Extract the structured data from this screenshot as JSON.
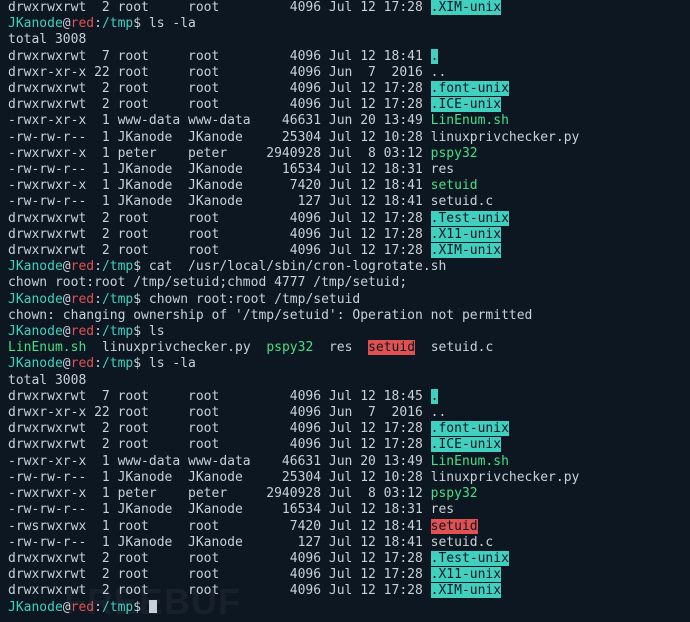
{
  "prompt": {
    "user": "JKanode",
    "at": "@",
    "host": "red",
    "colon": ":",
    "path": "/tmp",
    "dollar": "$ "
  },
  "truncated_line": {
    "perms": "drwxrwxrwt",
    "links": "2",
    "owner": "root",
    "group": "root",
    "size": "4096",
    "date": "Jul 12 17:28",
    "name": ".XIM-unix",
    "cls": "hl-teal"
  },
  "cmd1": "ls -la",
  "total1": "total 3008",
  "ls1": [
    {
      "perms": "drwxrwxrwt",
      "links": "7",
      "owner": "root",
      "group": "root",
      "size": "4096",
      "date": "Jul 12 18:41",
      "name": ".",
      "cls": "dir-current"
    },
    {
      "perms": "drwxr-xr-x",
      "links": "22",
      "owner": "root",
      "group": "root",
      "size": "4096",
      "date": "Jun  7  2016",
      "name": "..",
      "cls": "dim"
    },
    {
      "perms": "drwxrwxrwt",
      "links": "2",
      "owner": "root",
      "group": "root",
      "size": "4096",
      "date": "Jul 12 17:28",
      "name": ".font-unix",
      "cls": "hl-teal"
    },
    {
      "perms": "drwxrwxrwt",
      "links": "2",
      "owner": "root",
      "group": "root",
      "size": "4096",
      "date": "Jul 12 17:28",
      "name": ".ICE-unix",
      "cls": "hl-teal"
    },
    {
      "perms": "-rwxr-xr-x",
      "links": "1",
      "owner": "www-data",
      "group": "www-data",
      "size": "46631",
      "date": "Jun 20 13:49",
      "name": "LinEnum.sh",
      "cls": "green"
    },
    {
      "perms": "-rw-rw-r--",
      "links": "1",
      "owner": "JKanode",
      "group": "JKanode",
      "size": "25304",
      "date": "Jul 12 10:28",
      "name": "linuxprivchecker.py",
      "cls": "dim"
    },
    {
      "perms": "-rwxrwxr-x",
      "links": "1",
      "owner": "peter",
      "group": "peter",
      "size": "2940928",
      "date": "Jul  8 03:12",
      "name": "pspy32",
      "cls": "green"
    },
    {
      "perms": "-rw-rw-r--",
      "links": "1",
      "owner": "JKanode",
      "group": "JKanode",
      "size": "16534",
      "date": "Jul 12 18:31",
      "name": "res",
      "cls": "dim"
    },
    {
      "perms": "-rwxrwxr-x",
      "links": "1",
      "owner": "JKanode",
      "group": "JKanode",
      "size": "7420",
      "date": "Jul 12 18:41",
      "name": "setuid",
      "cls": "green"
    },
    {
      "perms": "-rw-rw-r--",
      "links": "1",
      "owner": "JKanode",
      "group": "JKanode",
      "size": "127",
      "date": "Jul 12 18:41",
      "name": "setuid.c",
      "cls": "dim"
    },
    {
      "perms": "drwxrwxrwt",
      "links": "2",
      "owner": "root",
      "group": "root",
      "size": "4096",
      "date": "Jul 12 17:28",
      "name": ".Test-unix",
      "cls": "hl-teal"
    },
    {
      "perms": "drwxrwxrwt",
      "links": "2",
      "owner": "root",
      "group": "root",
      "size": "4096",
      "date": "Jul 12 17:28",
      "name": ".X11-unix",
      "cls": "hl-teal"
    },
    {
      "perms": "drwxrwxrwt",
      "links": "2",
      "owner": "root",
      "group": "root",
      "size": "4096",
      "date": "Jul 12 17:28",
      "name": ".XIM-unix",
      "cls": "hl-teal"
    }
  ],
  "cmd2": "cat  /usr/local/sbin/cron-logrotate.sh",
  "cat_output": "chown root:root /tmp/setuid;chmod 4777 /tmp/setuid;",
  "cmd3": "chown root:root /tmp/setuid",
  "chown_err": "chown: changing ownership of '/tmp/setuid': Operation not permitted",
  "cmd4": "ls",
  "ls_short": [
    {
      "text": "LinEnum.sh",
      "cls": "green"
    },
    {
      "text": "linuxprivchecker.py",
      "cls": "dim"
    },
    {
      "text": "pspy32",
      "cls": "green"
    },
    {
      "text": "res",
      "cls": "dim"
    },
    {
      "text": "setuid",
      "cls": "red-bg"
    },
    {
      "text": "setuid.c",
      "cls": "dim"
    }
  ],
  "cmd5": "ls -la",
  "total2": "total 3008",
  "ls2": [
    {
      "perms": "drwxrwxrwt",
      "links": "7",
      "owner": "root",
      "group": "root",
      "size": "4096",
      "date": "Jul 12 18:45",
      "name": ".",
      "cls": "dir-current"
    },
    {
      "perms": "drwxr-xr-x",
      "links": "22",
      "owner": "root",
      "group": "root",
      "size": "4096",
      "date": "Jun  7  2016",
      "name": "..",
      "cls": "dim"
    },
    {
      "perms": "drwxrwxrwt",
      "links": "2",
      "owner": "root",
      "group": "root",
      "size": "4096",
      "date": "Jul 12 17:28",
      "name": ".font-unix",
      "cls": "hl-teal"
    },
    {
      "perms": "drwxrwxrwt",
      "links": "2",
      "owner": "root",
      "group": "root",
      "size": "4096",
      "date": "Jul 12 17:28",
      "name": ".ICE-unix",
      "cls": "hl-teal"
    },
    {
      "perms": "-rwxr-xr-x",
      "links": "1",
      "owner": "www-data",
      "group": "www-data",
      "size": "46631",
      "date": "Jun 20 13:49",
      "name": "LinEnum.sh",
      "cls": "green"
    },
    {
      "perms": "-rw-rw-r--",
      "links": "1",
      "owner": "JKanode",
      "group": "JKanode",
      "size": "25304",
      "date": "Jul 12 10:28",
      "name": "linuxprivchecker.py",
      "cls": "dim"
    },
    {
      "perms": "-rwxrwxr-x",
      "links": "1",
      "owner": "peter",
      "group": "peter",
      "size": "2940928",
      "date": "Jul  8 03:12",
      "name": "pspy32",
      "cls": "green"
    },
    {
      "perms": "-rw-rw-r--",
      "links": "1",
      "owner": "JKanode",
      "group": "JKanode",
      "size": "16534",
      "date": "Jul 12 18:31",
      "name": "res",
      "cls": "dim"
    },
    {
      "perms": "-rwsrwxrwx",
      "links": "1",
      "owner": "root",
      "group": "root",
      "size": "7420",
      "date": "Jul 12 18:41",
      "name": "setuid",
      "cls": "red-bg"
    },
    {
      "perms": "-rw-rw-r--",
      "links": "1",
      "owner": "JKanode",
      "group": "JKanode",
      "size": "127",
      "date": "Jul 12 18:41",
      "name": "setuid.c",
      "cls": "dim"
    },
    {
      "perms": "drwxrwxrwt",
      "links": "2",
      "owner": "root",
      "group": "root",
      "size": "4096",
      "date": "Jul 12 17:28",
      "name": ".Test-unix",
      "cls": "hl-teal"
    },
    {
      "perms": "drwxrwxrwt",
      "links": "2",
      "owner": "root",
      "group": "root",
      "size": "4096",
      "date": "Jul 12 17:28",
      "name": ".X11-unix",
      "cls": "hl-teal"
    },
    {
      "perms": "drwxrwxrwt",
      "links": "2",
      "owner": "root",
      "group": "root",
      "size": "4096",
      "date": "Jul 12 17:28",
      "name": ".XIM-unix",
      "cls": "hl-teal"
    }
  ],
  "watermark": "FREEBUF"
}
